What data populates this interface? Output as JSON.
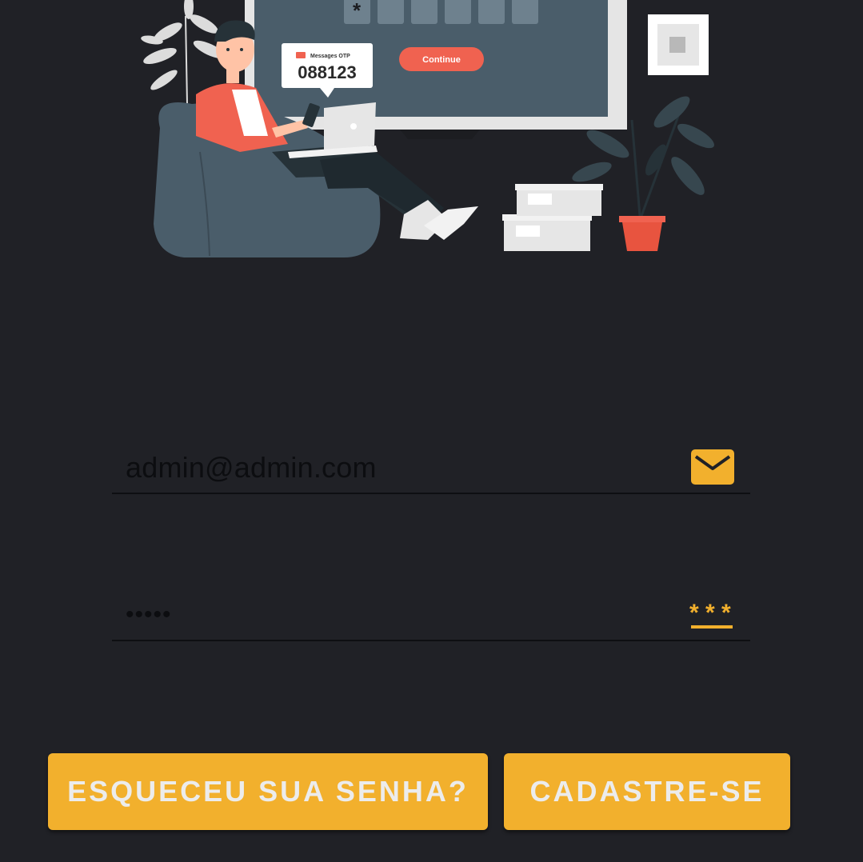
{
  "illustration": {
    "otp_tag": "Messages OTP",
    "otp_code": "088123",
    "continue_label": "Continue",
    "pin_mask": "*"
  },
  "login": {
    "email_value": "admin@admin.com",
    "password_value": "•••••"
  },
  "actions": {
    "forgot_label": "ESQUECEU SUA SENHA?",
    "signup_label": "CADASTRE-SE"
  },
  "icons": {
    "email": "envelope-icon",
    "password": "password-asterisk-icon"
  },
  "colors": {
    "background": "#202126",
    "accent": "#f2b02d",
    "button_text": "#ececec",
    "otp_button": "#f06250"
  }
}
